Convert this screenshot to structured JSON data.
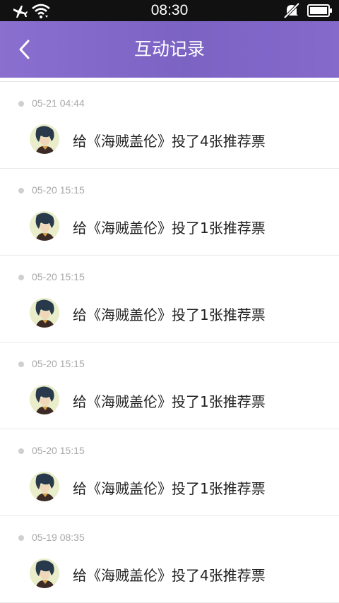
{
  "status_bar": {
    "time": "08:30",
    "icons": [
      "airplane-icon",
      "wifi-icon",
      "mute-icon",
      "battery-icon"
    ]
  },
  "nav": {
    "title": "互动记录",
    "back_icon": "chevron-left-icon"
  },
  "records": [
    {
      "time": "05-21 04:44",
      "text": "给《海贼盖伦》投了4张推荐票"
    },
    {
      "time": "05-20 15:15",
      "text": "给《海贼盖伦》投了1张推荐票"
    },
    {
      "time": "05-20 15:15",
      "text": "给《海贼盖伦》投了1张推荐票"
    },
    {
      "time": "05-20 15:15",
      "text": "给《海贼盖伦》投了1张推荐票"
    },
    {
      "time": "05-20 15:15",
      "text": "给《海贼盖伦》投了1张推荐票"
    },
    {
      "time": "05-19 08:35",
      "text": "给《海贼盖伦》投了4张推荐票"
    }
  ],
  "colors": {
    "nav_bg": "#7b63c4",
    "status_bg": "#111111",
    "timestamp": "#a8a8a8",
    "text": "#222222"
  }
}
